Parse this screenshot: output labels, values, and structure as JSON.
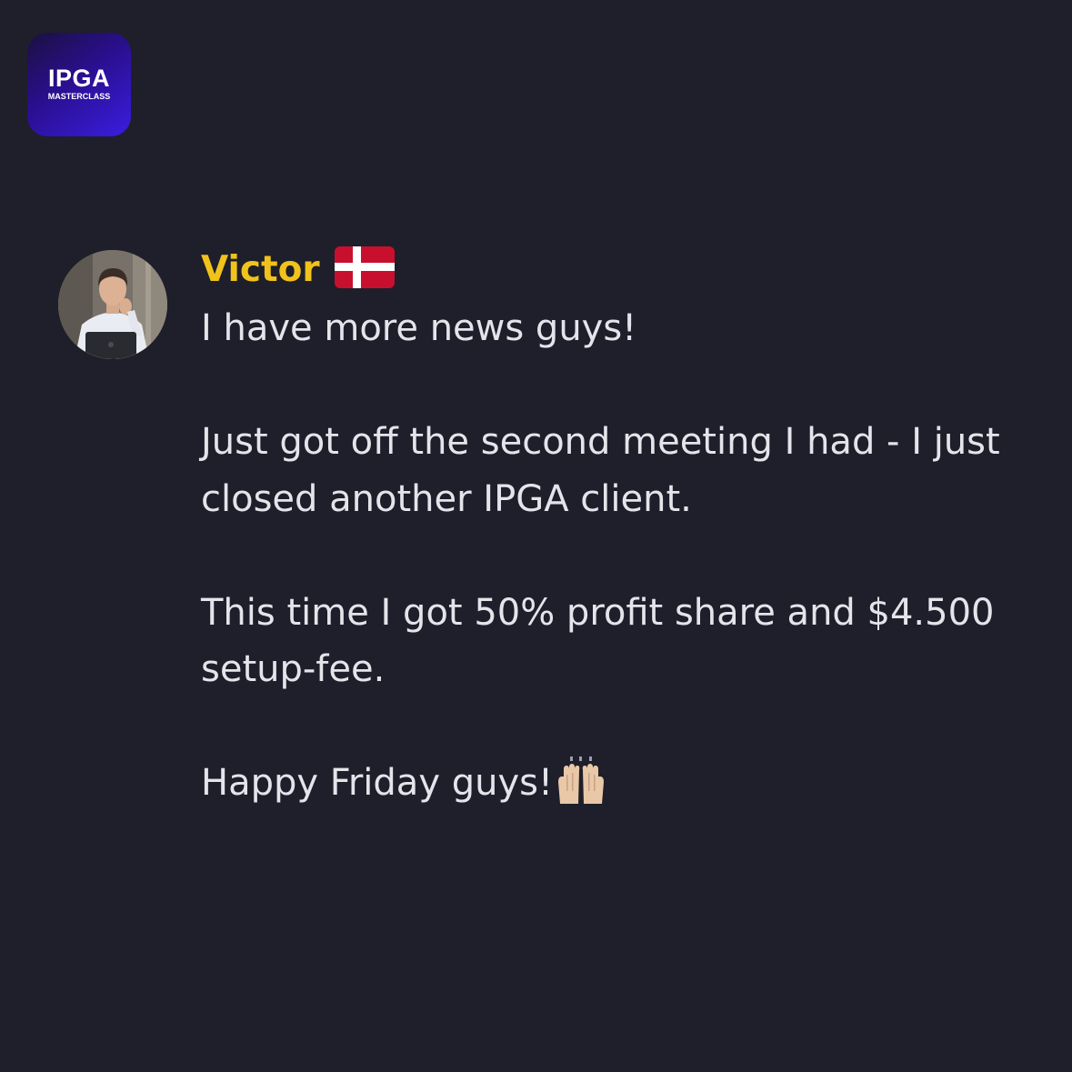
{
  "brand": {
    "title": "IPGA",
    "subtitle": "MASTERCLASS"
  },
  "message": {
    "author": "Victor",
    "author_flag_icon": "denmark-flag-icon",
    "author_color": "#f1c21b",
    "paragraphs": [
      "I have more news guys!",
      "Just got off the second meeting I had - I just closed another IPGA client.",
      "This time I got 50% profit share and $4.500 setup-fee.",
      "Happy Friday guys!"
    ],
    "trailing_emoji_icon": "raised-hands-icon"
  },
  "colors": {
    "background": "#1e1f2a",
    "text": "#e4e5ea",
    "logo_gradient_end": "#3a1de0"
  }
}
